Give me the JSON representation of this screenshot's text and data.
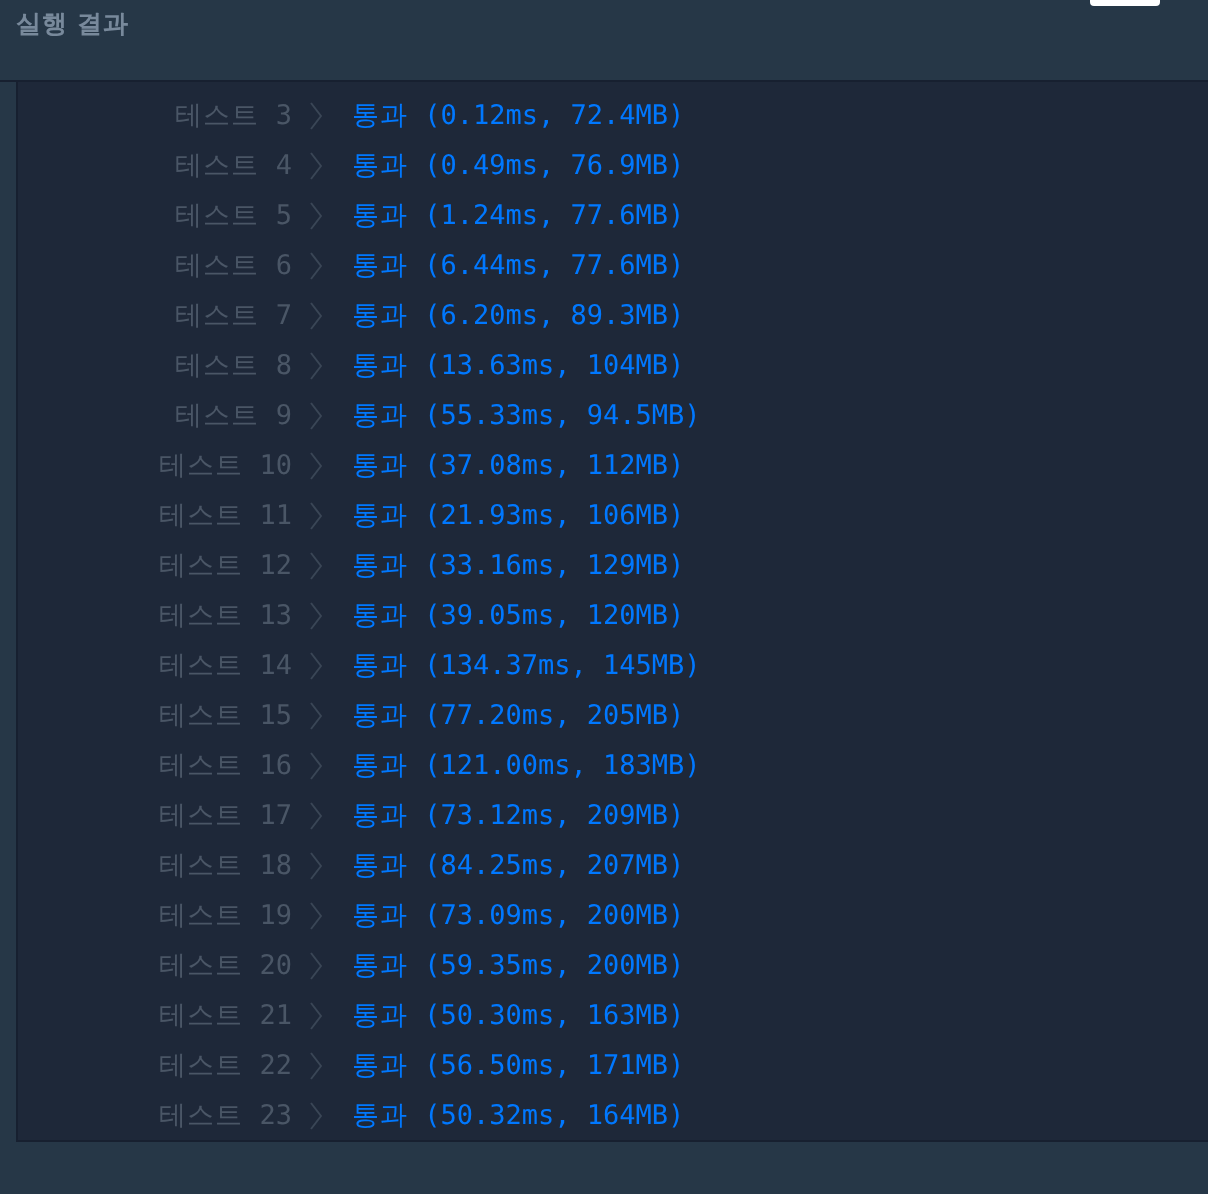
{
  "header": {
    "title": "실행 결과"
  },
  "results": [
    {
      "label": "테스트 3",
      "kind": "pass",
      "result": "통과 (0.12ms, 72.4MB)"
    },
    {
      "label": "테스트 4",
      "kind": "pass",
      "result": "통과 (0.49ms, 76.9MB)"
    },
    {
      "label": "테스트 5",
      "kind": "pass",
      "result": "통과 (1.24ms, 77.6MB)"
    },
    {
      "label": "테스트 6",
      "kind": "pass",
      "result": "통과 (6.44ms, 77.6MB)"
    },
    {
      "label": "테스트 7",
      "kind": "pass",
      "result": "통과 (6.20ms, 89.3MB)"
    },
    {
      "label": "테스트 8",
      "kind": "pass",
      "result": "통과 (13.63ms, 104MB)"
    },
    {
      "label": "테스트 9",
      "kind": "pass",
      "result": "통과 (55.33ms, 94.5MB)"
    },
    {
      "label": "테스트 10",
      "kind": "pass",
      "result": "통과 (37.08ms, 112MB)"
    },
    {
      "label": "테스트 11",
      "kind": "pass",
      "result": "통과 (21.93ms, 106MB)"
    },
    {
      "label": "테스트 12",
      "kind": "pass",
      "result": "통과 (33.16ms, 129MB)"
    },
    {
      "label": "테스트 13",
      "kind": "pass",
      "result": "통과 (39.05ms, 120MB)"
    },
    {
      "label": "테스트 14",
      "kind": "pass",
      "result": "통과 (134.37ms, 145MB)"
    },
    {
      "label": "테스트 15",
      "kind": "pass",
      "result": "통과 (77.20ms, 205MB)"
    },
    {
      "label": "테스트 16",
      "kind": "pass",
      "result": "통과 (121.00ms, 183MB)"
    },
    {
      "label": "테스트 17",
      "kind": "pass",
      "result": "통과 (73.12ms, 209MB)"
    },
    {
      "label": "테스트 18",
      "kind": "pass",
      "result": "통과 (84.25ms, 207MB)"
    },
    {
      "label": "테스트 19",
      "kind": "pass",
      "result": "통과 (73.09ms, 200MB)"
    },
    {
      "label": "테스트 20",
      "kind": "pass",
      "result": "통과 (59.35ms, 200MB)"
    },
    {
      "label": "테스트 21",
      "kind": "pass",
      "result": "통과 (50.30ms, 163MB)"
    },
    {
      "label": "테스트 22",
      "kind": "pass",
      "result": "통과 (56.50ms, 171MB)"
    },
    {
      "label": "테스트 23",
      "kind": "pass",
      "result": "통과 (50.32ms, 164MB)"
    }
  ]
}
